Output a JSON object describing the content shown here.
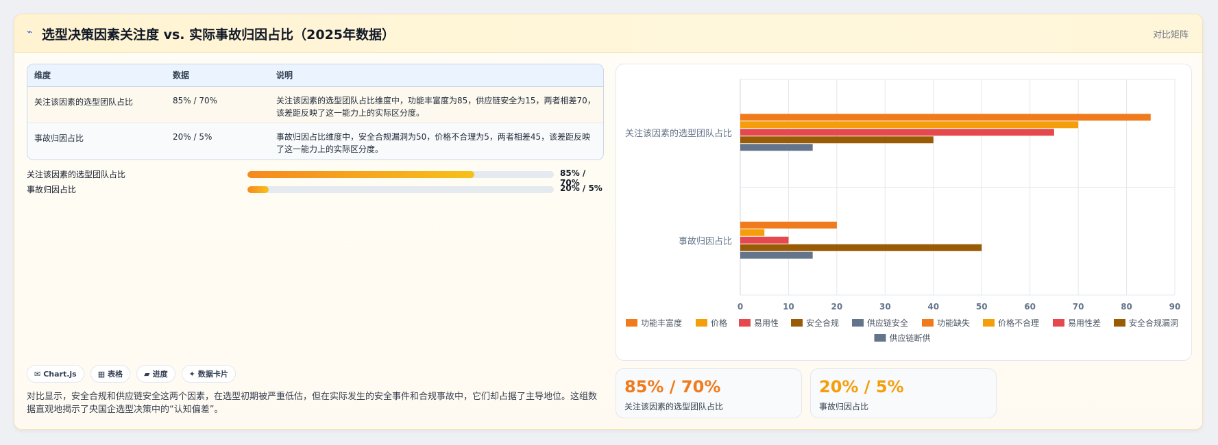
{
  "header": {
    "title_icon": "⌁",
    "title": "选型决策因素关注度 vs. 实际事故归因占比（2025年数据）",
    "mode": "对比矩阵"
  },
  "table": {
    "headers": [
      "维度",
      "数据",
      "说明"
    ],
    "rows": [
      {
        "dimension": "关注该因素的选型团队占比",
        "data": "85% / 70%",
        "desc": "关注该因素的选型团队占比维度中，功能丰富度为85，供应链安全为15，两者相差70，该差距反映了这一能力上的实际区分度。"
      },
      {
        "dimension": "事故归因占比",
        "data": "20% / 5%",
        "desc": "事故归因占比维度中，安全合规漏洞为50，价格不合理为5，两者相差45，该差距反映了这一能力上的实际区分度。"
      }
    ]
  },
  "progress": [
    {
      "label": "关注该因素的选型团队占比",
      "value_text": "85% / 70%",
      "fill": 0.74
    },
    {
      "label": "事故归因占比",
      "value_text": "20% / 5%",
      "fill": 0.07
    }
  ],
  "chips": [
    {
      "icon": "✉",
      "label": "Chart.js"
    },
    {
      "icon": "▦",
      "label": "表格"
    },
    {
      "icon": "▰",
      "label": "进度"
    },
    {
      "icon": "✦",
      "label": "数据卡片"
    }
  ],
  "summary": "对比显示，安全合规和供应链安全这两个因素，在选型初期被严重低估，但在实际发生的安全事件和合规事故中，它们却占据了主导地位。这组数据直观地揭示了央国企选型决策中的“认知偏差”。",
  "stats": [
    {
      "value": "85% / 70%",
      "label": "关注该因素的选型团队占比",
      "color": "#f07b1d"
    },
    {
      "value": "20% / 5%",
      "label": "事故归因占比",
      "color": "#f59e0b"
    }
  ],
  "chart_data": {
    "type": "bar",
    "orientation": "horizontal",
    "categories": [
      "关注该因素的选型团队占比",
      "事故归因占比"
    ],
    "xlim": [
      0,
      90
    ],
    "xticks": [
      0,
      10,
      20,
      30,
      40,
      50,
      60,
      70,
      80,
      90
    ],
    "grid": true,
    "legend_position": "bottom",
    "series": [
      {
        "name": "功能丰富度",
        "color": "#f07b1d",
        "values": [
          85,
          null
        ]
      },
      {
        "name": "价格",
        "color": "#f59e0b",
        "values": [
          70,
          null
        ]
      },
      {
        "name": "易用性",
        "color": "#e5484d",
        "values": [
          65,
          null
        ]
      },
      {
        "name": "安全合规",
        "color": "#9a5b07",
        "values": [
          40,
          null
        ]
      },
      {
        "name": "供应链安全",
        "color": "#64748b",
        "values": [
          15,
          null
        ]
      },
      {
        "name": "功能缺失",
        "color": "#f07b1d",
        "values": [
          null,
          20
        ]
      },
      {
        "name": "价格不合理",
        "color": "#f59e0b",
        "values": [
          null,
          5
        ]
      },
      {
        "name": "易用性差",
        "color": "#e5484d",
        "values": [
          null,
          10
        ]
      },
      {
        "name": "安全合规漏洞",
        "color": "#9a5b07",
        "values": [
          null,
          50
        ]
      },
      {
        "name": "供应链断供",
        "color": "#64748b",
        "values": [
          null,
          15
        ]
      }
    ]
  }
}
